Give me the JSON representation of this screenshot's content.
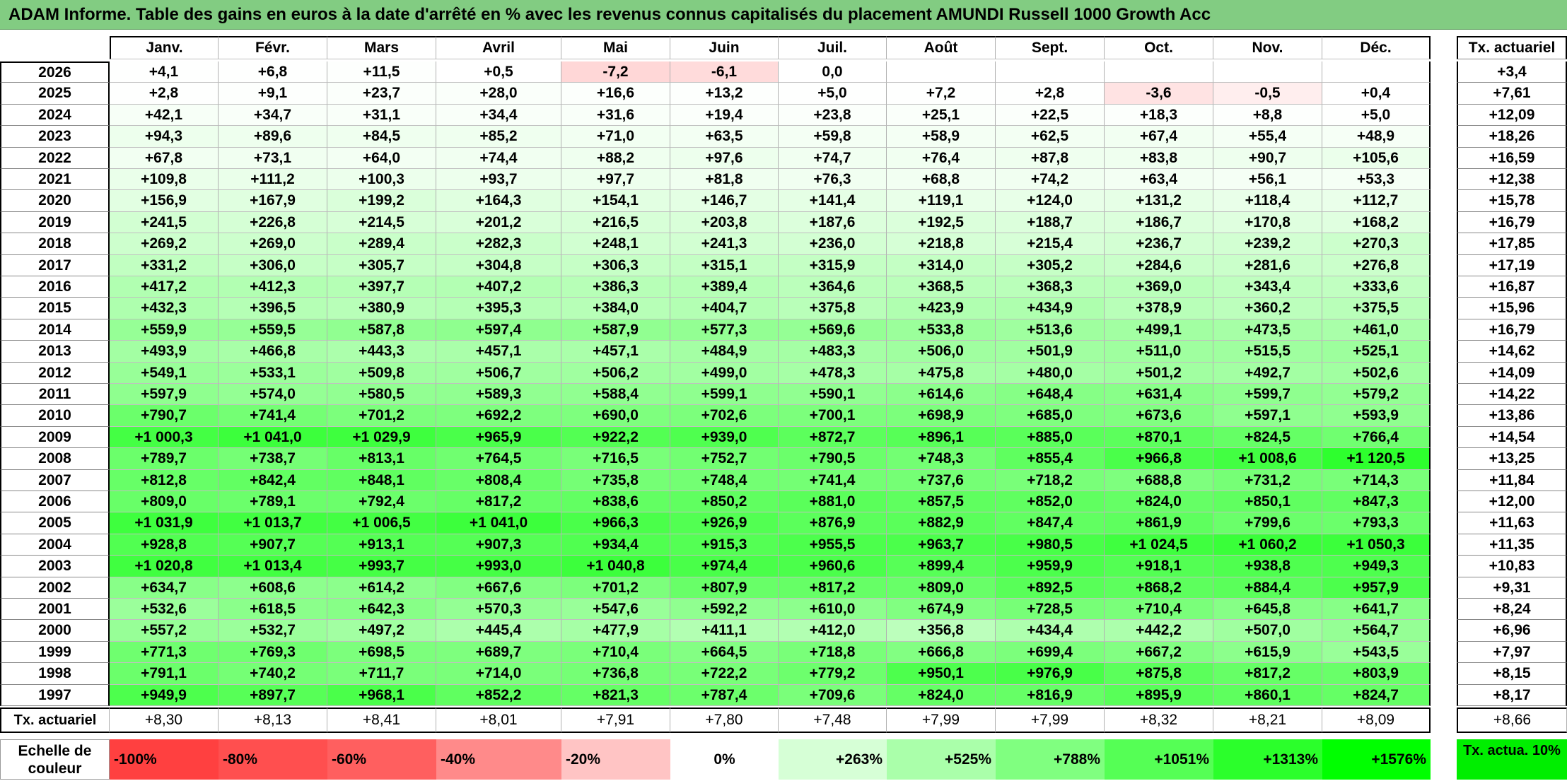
{
  "title": "ADAM Informe. Table des gains en euros à la date d'arrêté en % avec les revenus connus capitalisés du placement AMUNDI Russell 1000 Growth Acc",
  "months": [
    "Janv.",
    "Févr.",
    "Mars",
    "Avril",
    "Mai",
    "Juin",
    "Juil.",
    "Août",
    "Sept.",
    "Oct.",
    "Nov.",
    "Déc."
  ],
  "final_header": "Tx. actuariel",
  "rows": [
    {
      "year": "2026",
      "values": [
        "+4,1",
        "+6,8",
        "+11,5",
        "+0,5",
        "-7,2",
        "-6,1",
        "0,0",
        "",
        "",
        "",
        "",
        ""
      ],
      "final": "+3,4"
    },
    {
      "year": "2025",
      "values": [
        "+2,8",
        "+9,1",
        "+23,7",
        "+28,0",
        "+16,6",
        "+13,2",
        "+5,0",
        "+7,2",
        "+2,8",
        "-3,6",
        "-0,5",
        "+0,4"
      ],
      "final": "+7,61"
    },
    {
      "year": "2024",
      "values": [
        "+42,1",
        "+34,7",
        "+31,1",
        "+34,4",
        "+31,6",
        "+19,4",
        "+23,8",
        "+25,1",
        "+22,5",
        "+18,3",
        "+8,8",
        "+5,0"
      ],
      "final": "+12,09"
    },
    {
      "year": "2023",
      "values": [
        "+94,3",
        "+89,6",
        "+84,5",
        "+85,2",
        "+71,0",
        "+63,5",
        "+59,8",
        "+58,9",
        "+62,5",
        "+67,4",
        "+55,4",
        "+48,9"
      ],
      "final": "+18,26"
    },
    {
      "year": "2022",
      "values": [
        "+67,8",
        "+73,1",
        "+64,0",
        "+74,4",
        "+88,2",
        "+97,6",
        "+74,7",
        "+76,4",
        "+87,8",
        "+83,8",
        "+90,7",
        "+105,6"
      ],
      "final": "+16,59"
    },
    {
      "year": "2021",
      "values": [
        "+109,8",
        "+111,2",
        "+100,3",
        "+93,7",
        "+97,7",
        "+81,8",
        "+76,3",
        "+68,8",
        "+74,2",
        "+63,4",
        "+56,1",
        "+53,3"
      ],
      "final": "+12,38"
    },
    {
      "year": "2020",
      "values": [
        "+156,9",
        "+167,9",
        "+199,2",
        "+164,3",
        "+154,1",
        "+146,7",
        "+141,4",
        "+119,1",
        "+124,0",
        "+131,2",
        "+118,4",
        "+112,7"
      ],
      "final": "+15,78"
    },
    {
      "year": "2019",
      "values": [
        "+241,5",
        "+226,8",
        "+214,5",
        "+201,2",
        "+216,5",
        "+203,8",
        "+187,6",
        "+192,5",
        "+188,7",
        "+186,7",
        "+170,8",
        "+168,2"
      ],
      "final": "+16,79"
    },
    {
      "year": "2018",
      "values": [
        "+269,2",
        "+269,0",
        "+289,4",
        "+282,3",
        "+248,1",
        "+241,3",
        "+236,0",
        "+218,8",
        "+215,4",
        "+236,7",
        "+239,2",
        "+270,3"
      ],
      "final": "+17,85"
    },
    {
      "year": "2017",
      "values": [
        "+331,2",
        "+306,0",
        "+305,7",
        "+304,8",
        "+306,3",
        "+315,1",
        "+315,9",
        "+314,0",
        "+305,2",
        "+284,6",
        "+281,6",
        "+276,8"
      ],
      "final": "+17,19"
    },
    {
      "year": "2016",
      "values": [
        "+417,2",
        "+412,3",
        "+397,7",
        "+407,2",
        "+386,3",
        "+389,4",
        "+364,6",
        "+368,5",
        "+368,3",
        "+369,0",
        "+343,4",
        "+333,6"
      ],
      "final": "+16,87"
    },
    {
      "year": "2015",
      "values": [
        "+432,3",
        "+396,5",
        "+380,9",
        "+395,3",
        "+384,0",
        "+404,7",
        "+375,8",
        "+423,9",
        "+434,9",
        "+378,9",
        "+360,2",
        "+375,5"
      ],
      "final": "+15,96"
    },
    {
      "year": "2014",
      "values": [
        "+559,9",
        "+559,5",
        "+587,8",
        "+597,4",
        "+587,9",
        "+577,3",
        "+569,6",
        "+533,8",
        "+513,6",
        "+499,1",
        "+473,5",
        "+461,0"
      ],
      "final": "+16,79"
    },
    {
      "year": "2013",
      "values": [
        "+493,9",
        "+466,8",
        "+443,3",
        "+457,1",
        "+457,1",
        "+484,9",
        "+483,3",
        "+506,0",
        "+501,9",
        "+511,0",
        "+515,5",
        "+525,1"
      ],
      "final": "+14,62"
    },
    {
      "year": "2012",
      "values": [
        "+549,1",
        "+533,1",
        "+509,8",
        "+506,7",
        "+506,2",
        "+499,0",
        "+478,3",
        "+475,8",
        "+480,0",
        "+501,2",
        "+492,7",
        "+502,6"
      ],
      "final": "+14,09"
    },
    {
      "year": "2011",
      "values": [
        "+597,9",
        "+574,0",
        "+580,5",
        "+589,3",
        "+588,4",
        "+599,1",
        "+590,1",
        "+614,6",
        "+648,4",
        "+631,4",
        "+599,7",
        "+579,2"
      ],
      "final": "+14,22"
    },
    {
      "year": "2010",
      "values": [
        "+790,7",
        "+741,4",
        "+701,2",
        "+692,2",
        "+690,0",
        "+702,6",
        "+700,1",
        "+698,9",
        "+685,0",
        "+673,6",
        "+597,1",
        "+593,9"
      ],
      "final": "+13,86"
    },
    {
      "year": "2009",
      "values": [
        "+1 000,3",
        "+1 041,0",
        "+1 029,9",
        "+965,9",
        "+922,2",
        "+939,0",
        "+872,7",
        "+896,1",
        "+885,0",
        "+870,1",
        "+824,5",
        "+766,4"
      ],
      "final": "+14,54"
    },
    {
      "year": "2008",
      "values": [
        "+789,7",
        "+738,7",
        "+813,1",
        "+764,5",
        "+716,5",
        "+752,7",
        "+790,5",
        "+748,3",
        "+855,4",
        "+966,8",
        "+1 008,6",
        "+1 120,5"
      ],
      "final": "+13,25"
    },
    {
      "year": "2007",
      "values": [
        "+812,8",
        "+842,4",
        "+848,1",
        "+808,4",
        "+735,8",
        "+748,4",
        "+741,4",
        "+737,6",
        "+718,2",
        "+688,8",
        "+731,2",
        "+714,3"
      ],
      "final": "+11,84"
    },
    {
      "year": "2006",
      "values": [
        "+809,0",
        "+789,1",
        "+792,4",
        "+817,2",
        "+838,6",
        "+850,2",
        "+881,0",
        "+857,5",
        "+852,0",
        "+824,0",
        "+850,1",
        "+847,3"
      ],
      "final": "+12,00"
    },
    {
      "year": "2005",
      "values": [
        "+1 031,9",
        "+1 013,7",
        "+1 006,5",
        "+1 041,0",
        "+966,3",
        "+926,9",
        "+876,9",
        "+882,9",
        "+847,4",
        "+861,9",
        "+799,6",
        "+793,3"
      ],
      "final": "+11,63"
    },
    {
      "year": "2004",
      "values": [
        "+928,8",
        "+907,7",
        "+913,1",
        "+907,3",
        "+934,4",
        "+915,3",
        "+955,5",
        "+963,7",
        "+980,5",
        "+1 024,5",
        "+1 060,2",
        "+1 050,3"
      ],
      "final": "+11,35"
    },
    {
      "year": "2003",
      "values": [
        "+1 020,8",
        "+1 013,4",
        "+993,7",
        "+993,0",
        "+1 040,8",
        "+974,4",
        "+960,6",
        "+899,4",
        "+959,9",
        "+918,1",
        "+938,8",
        "+949,3"
      ],
      "final": "+10,83"
    },
    {
      "year": "2002",
      "values": [
        "+634,7",
        "+608,6",
        "+614,2",
        "+667,6",
        "+701,2",
        "+807,9",
        "+817,2",
        "+809,0",
        "+892,5",
        "+868,2",
        "+884,4",
        "+957,9"
      ],
      "final": "+9,31"
    },
    {
      "year": "2001",
      "values": [
        "+532,6",
        "+618,5",
        "+642,3",
        "+570,3",
        "+547,6",
        "+592,2",
        "+610,0",
        "+674,9",
        "+728,5",
        "+710,4",
        "+645,8",
        "+641,7"
      ],
      "final": "+8,24"
    },
    {
      "year": "2000",
      "values": [
        "+557,2",
        "+532,7",
        "+497,2",
        "+445,4",
        "+477,9",
        "+411,1",
        "+412,0",
        "+356,8",
        "+434,4",
        "+442,2",
        "+507,0",
        "+564,7"
      ],
      "final": "+6,96"
    },
    {
      "year": "1999",
      "values": [
        "+771,3",
        "+769,3",
        "+698,5",
        "+689,7",
        "+710,4",
        "+664,5",
        "+718,8",
        "+666,8",
        "+699,4",
        "+667,2",
        "+615,9",
        "+543,5"
      ],
      "final": "+7,97"
    },
    {
      "year": "1998",
      "values": [
        "+791,1",
        "+740,2",
        "+711,7",
        "+714,0",
        "+736,8",
        "+722,2",
        "+779,2",
        "+950,1",
        "+976,9",
        "+875,8",
        "+817,2",
        "+803,9"
      ],
      "final": "+8,15"
    },
    {
      "year": "1997",
      "values": [
        "+949,9",
        "+897,7",
        "+968,1",
        "+852,2",
        "+821,3",
        "+787,4",
        "+709,6",
        "+824,0",
        "+816,9",
        "+895,9",
        "+860,1",
        "+824,7"
      ],
      "final": "+8,17"
    }
  ],
  "tx_row": {
    "label": "Tx. actuariel",
    "values": [
      "+8,30",
      "+8,13",
      "+8,41",
      "+8,01",
      "+7,91",
      "+7,80",
      "+7,48",
      "+7,99",
      "+7,99",
      "+8,32",
      "+8,21",
      "+8,09"
    ],
    "final": "+8,66"
  },
  "legend": {
    "label": "Echelle de couleur",
    "items": [
      {
        "text": "-100%",
        "color": "#ff4040",
        "align": "left"
      },
      {
        "text": "-80%",
        "color": "#ff4f4f",
        "align": "left"
      },
      {
        "text": "-60%",
        "color": "#ff5f5f",
        "align": "left"
      },
      {
        "text": "-40%",
        "color": "#ff8a8a",
        "align": "left"
      },
      {
        "text": "-20%",
        "color": "#ffc4c4",
        "align": "left"
      },
      {
        "text": "0%",
        "color": "#ffffff",
        "align": "center"
      },
      {
        "text": "+263%",
        "color": "#d6ffd6",
        "align": "right"
      },
      {
        "text": "+525%",
        "color": "#aaffaa",
        "align": "right"
      },
      {
        "text": "+788%",
        "color": "#80ff80",
        "align": "right"
      },
      {
        "text": "+1051%",
        "color": "#55ff55",
        "align": "right"
      },
      {
        "text": "+1313%",
        "color": "#2bff2b",
        "align": "right"
      },
      {
        "text": "+1576%",
        "color": "#00ff00",
        "align": "right"
      }
    ],
    "final_text": "Tx. actua. 10%",
    "final_color": "#00ee00"
  },
  "colors": {
    "title_bg": "#82cc82",
    "max_green": "#00ff00",
    "negative": "#ff6060"
  }
}
